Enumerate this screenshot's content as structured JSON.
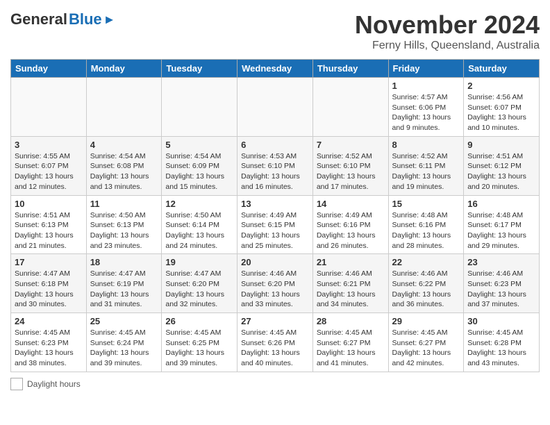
{
  "header": {
    "logo_general": "General",
    "logo_blue": "Blue",
    "month_title": "November 2024",
    "location": "Ferny Hills, Queensland, Australia"
  },
  "days_of_week": [
    "Sunday",
    "Monday",
    "Tuesday",
    "Wednesday",
    "Thursday",
    "Friday",
    "Saturday"
  ],
  "footer": {
    "label": "Daylight hours"
  },
  "weeks": [
    [
      {
        "day": "",
        "info": ""
      },
      {
        "day": "",
        "info": ""
      },
      {
        "day": "",
        "info": ""
      },
      {
        "day": "",
        "info": ""
      },
      {
        "day": "",
        "info": ""
      },
      {
        "day": "1",
        "info": "Sunrise: 4:57 AM\nSunset: 6:06 PM\nDaylight: 13 hours and 9 minutes."
      },
      {
        "day": "2",
        "info": "Sunrise: 4:56 AM\nSunset: 6:07 PM\nDaylight: 13 hours and 10 minutes."
      }
    ],
    [
      {
        "day": "3",
        "info": "Sunrise: 4:55 AM\nSunset: 6:07 PM\nDaylight: 13 hours and 12 minutes."
      },
      {
        "day": "4",
        "info": "Sunrise: 4:54 AM\nSunset: 6:08 PM\nDaylight: 13 hours and 13 minutes."
      },
      {
        "day": "5",
        "info": "Sunrise: 4:54 AM\nSunset: 6:09 PM\nDaylight: 13 hours and 15 minutes."
      },
      {
        "day": "6",
        "info": "Sunrise: 4:53 AM\nSunset: 6:10 PM\nDaylight: 13 hours and 16 minutes."
      },
      {
        "day": "7",
        "info": "Sunrise: 4:52 AM\nSunset: 6:10 PM\nDaylight: 13 hours and 17 minutes."
      },
      {
        "day": "8",
        "info": "Sunrise: 4:52 AM\nSunset: 6:11 PM\nDaylight: 13 hours and 19 minutes."
      },
      {
        "day": "9",
        "info": "Sunrise: 4:51 AM\nSunset: 6:12 PM\nDaylight: 13 hours and 20 minutes."
      }
    ],
    [
      {
        "day": "10",
        "info": "Sunrise: 4:51 AM\nSunset: 6:13 PM\nDaylight: 13 hours and 21 minutes."
      },
      {
        "day": "11",
        "info": "Sunrise: 4:50 AM\nSunset: 6:13 PM\nDaylight: 13 hours and 23 minutes."
      },
      {
        "day": "12",
        "info": "Sunrise: 4:50 AM\nSunset: 6:14 PM\nDaylight: 13 hours and 24 minutes."
      },
      {
        "day": "13",
        "info": "Sunrise: 4:49 AM\nSunset: 6:15 PM\nDaylight: 13 hours and 25 minutes."
      },
      {
        "day": "14",
        "info": "Sunrise: 4:49 AM\nSunset: 6:16 PM\nDaylight: 13 hours and 26 minutes."
      },
      {
        "day": "15",
        "info": "Sunrise: 4:48 AM\nSunset: 6:16 PM\nDaylight: 13 hours and 28 minutes."
      },
      {
        "day": "16",
        "info": "Sunrise: 4:48 AM\nSunset: 6:17 PM\nDaylight: 13 hours and 29 minutes."
      }
    ],
    [
      {
        "day": "17",
        "info": "Sunrise: 4:47 AM\nSunset: 6:18 PM\nDaylight: 13 hours and 30 minutes."
      },
      {
        "day": "18",
        "info": "Sunrise: 4:47 AM\nSunset: 6:19 PM\nDaylight: 13 hours and 31 minutes."
      },
      {
        "day": "19",
        "info": "Sunrise: 4:47 AM\nSunset: 6:20 PM\nDaylight: 13 hours and 32 minutes."
      },
      {
        "day": "20",
        "info": "Sunrise: 4:46 AM\nSunset: 6:20 PM\nDaylight: 13 hours and 33 minutes."
      },
      {
        "day": "21",
        "info": "Sunrise: 4:46 AM\nSunset: 6:21 PM\nDaylight: 13 hours and 34 minutes."
      },
      {
        "day": "22",
        "info": "Sunrise: 4:46 AM\nSunset: 6:22 PM\nDaylight: 13 hours and 36 minutes."
      },
      {
        "day": "23",
        "info": "Sunrise: 4:46 AM\nSunset: 6:23 PM\nDaylight: 13 hours and 37 minutes."
      }
    ],
    [
      {
        "day": "24",
        "info": "Sunrise: 4:45 AM\nSunset: 6:23 PM\nDaylight: 13 hours and 38 minutes."
      },
      {
        "day": "25",
        "info": "Sunrise: 4:45 AM\nSunset: 6:24 PM\nDaylight: 13 hours and 39 minutes."
      },
      {
        "day": "26",
        "info": "Sunrise: 4:45 AM\nSunset: 6:25 PM\nDaylight: 13 hours and 39 minutes."
      },
      {
        "day": "27",
        "info": "Sunrise: 4:45 AM\nSunset: 6:26 PM\nDaylight: 13 hours and 40 minutes."
      },
      {
        "day": "28",
        "info": "Sunrise: 4:45 AM\nSunset: 6:27 PM\nDaylight: 13 hours and 41 minutes."
      },
      {
        "day": "29",
        "info": "Sunrise: 4:45 AM\nSunset: 6:27 PM\nDaylight: 13 hours and 42 minutes."
      },
      {
        "day": "30",
        "info": "Sunrise: 4:45 AM\nSunset: 6:28 PM\nDaylight: 13 hours and 43 minutes."
      }
    ]
  ]
}
